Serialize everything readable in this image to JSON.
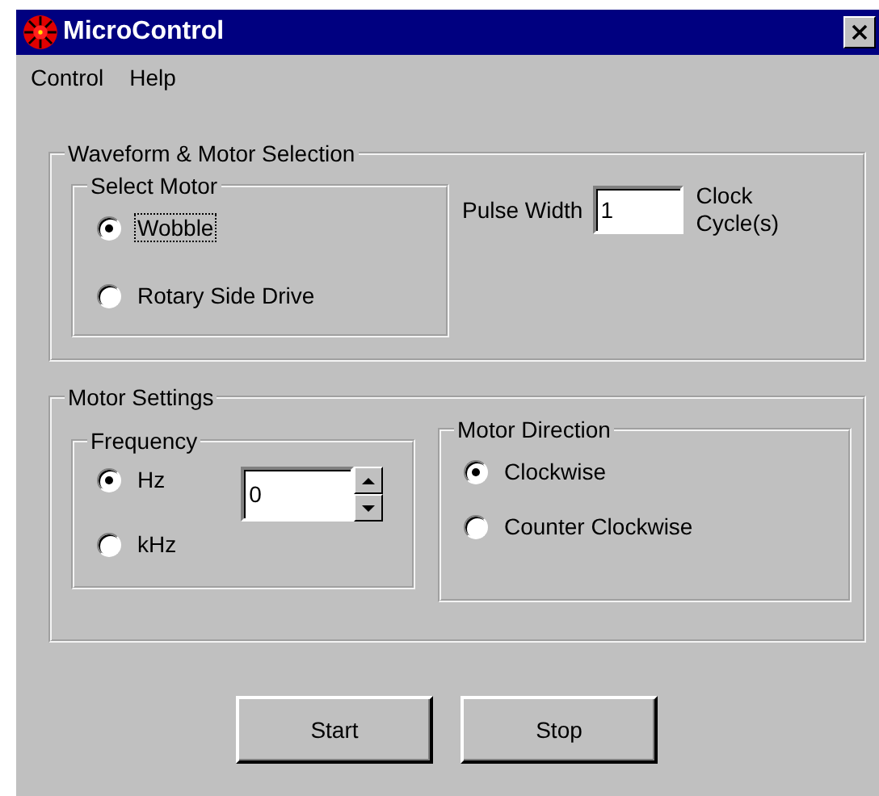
{
  "window": {
    "title": "MicroControl"
  },
  "menu": [
    {
      "label": "Control"
    },
    {
      "label": "Help"
    }
  ],
  "waveform_group": {
    "title": "Waveform & Motor Selection",
    "select_motor": {
      "title": "Select Motor",
      "options": [
        {
          "label": "Wobble",
          "selected": true,
          "focused": true
        },
        {
          "label": "Rotary Side Drive",
          "selected": false,
          "focused": false
        }
      ]
    },
    "pulse_width": {
      "label": "Pulse Width",
      "value": "1",
      "unit": "Clock Cycle(s)"
    }
  },
  "motor_settings": {
    "title": "Motor Settings",
    "frequency": {
      "title": "Frequency",
      "value": "0",
      "options": [
        {
          "label": "Hz",
          "selected": true
        },
        {
          "label": "kHz",
          "selected": false
        }
      ]
    },
    "direction": {
      "title": "Motor Direction",
      "options": [
        {
          "label": "Clockwise",
          "selected": true
        },
        {
          "label": "Counter Clockwise",
          "selected": false
        }
      ]
    }
  },
  "buttons": [
    {
      "label": "Start"
    },
    {
      "label": "Stop"
    }
  ]
}
